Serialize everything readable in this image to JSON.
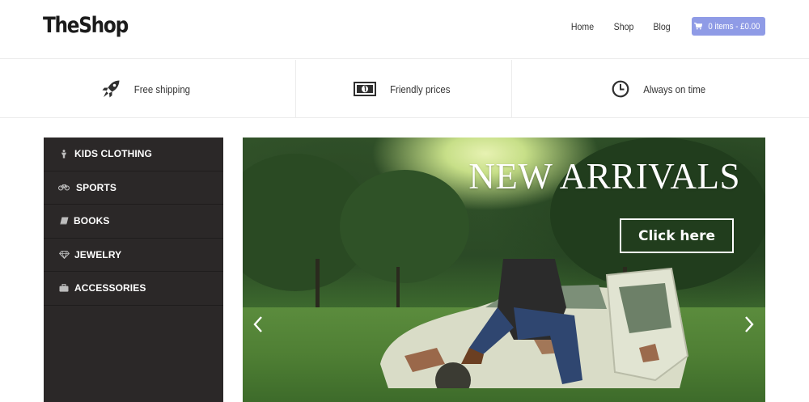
{
  "header": {
    "logo": "TheShop",
    "nav": [
      {
        "label": "Home"
      },
      {
        "label": "Shop"
      },
      {
        "label": "Blog"
      }
    ],
    "cart": {
      "label": "0 items - £0.00",
      "icon": "cart-icon",
      "color": "#8f9be6"
    }
  },
  "features": [
    {
      "label": "Free shipping",
      "icon": "rocket-icon"
    },
    {
      "label": "Friendly prices",
      "icon": "money-icon"
    },
    {
      "label": "Always on time",
      "icon": "clock-icon"
    }
  ],
  "sidebar": {
    "items": [
      {
        "label": "KIDS CLOTHING",
        "icon": "child-icon"
      },
      {
        "label": "SPORTS",
        "icon": "bicycle-icon"
      },
      {
        "label": "BOOKS",
        "icon": "book-icon"
      },
      {
        "label": "JEWELRY",
        "icon": "diamond-icon"
      },
      {
        "label": "ACCESSORIES",
        "icon": "briefcase-icon"
      }
    ],
    "background": "#2b2828"
  },
  "hero": {
    "title": "NEW ARRIVALS",
    "cta": "Click here",
    "prev_icon": "chevron-left-icon",
    "next_icon": "chevron-right-icon"
  }
}
